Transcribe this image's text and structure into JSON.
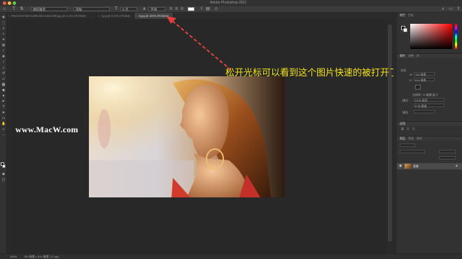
{
  "window": {
    "title": "Adobe Photoshop 2021"
  },
  "options_bar": {
    "font_family": "微软雅黑",
    "font_style": "常规",
    "font_size": "8 点",
    "anti_alias": "平滑"
  },
  "tabs": [
    {
      "label": "R5ef1f1e8762f1b2f8f1f301f46f12f4f6.jpg @ 11.8% (RGB/8#)",
      "active": false
    },
    {
      "label": "2.jpg @ 5.09% (RGB/8)",
      "active": false
    },
    {
      "label": "3.jpg @ 100% (RGB/8#)",
      "active": true
    }
  ],
  "tooltip": "3.jpg @ 100% (RGB/8#)",
  "watermark": "www.MacW.com",
  "annotation": "松开光标可以看到这个图片快速的被打开了",
  "status": {
    "zoom": "100%",
    "doc_info": "780 像素 x 510 像素 (72 ppi)"
  },
  "panels": {
    "color_tabs": [
      "颜色",
      "色板"
    ],
    "properties_tabs": [
      "属性",
      "调整",
      "库"
    ],
    "doc_label": "文档",
    "width_label": "W",
    "width_value": "780 像素",
    "height_label": "H",
    "height_value": "510 像素",
    "resolution": "分辨率: 72 像素/英寸",
    "mode_label": "模式",
    "mode_value": "RGB 颜色",
    "depth_value": "8 位/通道",
    "fill_label": "填充",
    "para_label": "段落",
    "layers_tabs": [
      "图层",
      "通道",
      "路径"
    ],
    "layer_name": "背景"
  },
  "colors": {
    "annotation": "#f4e21b",
    "arrow": "#e0413a",
    "canvas_bg": "#282828",
    "panel_bg": "#323232"
  }
}
